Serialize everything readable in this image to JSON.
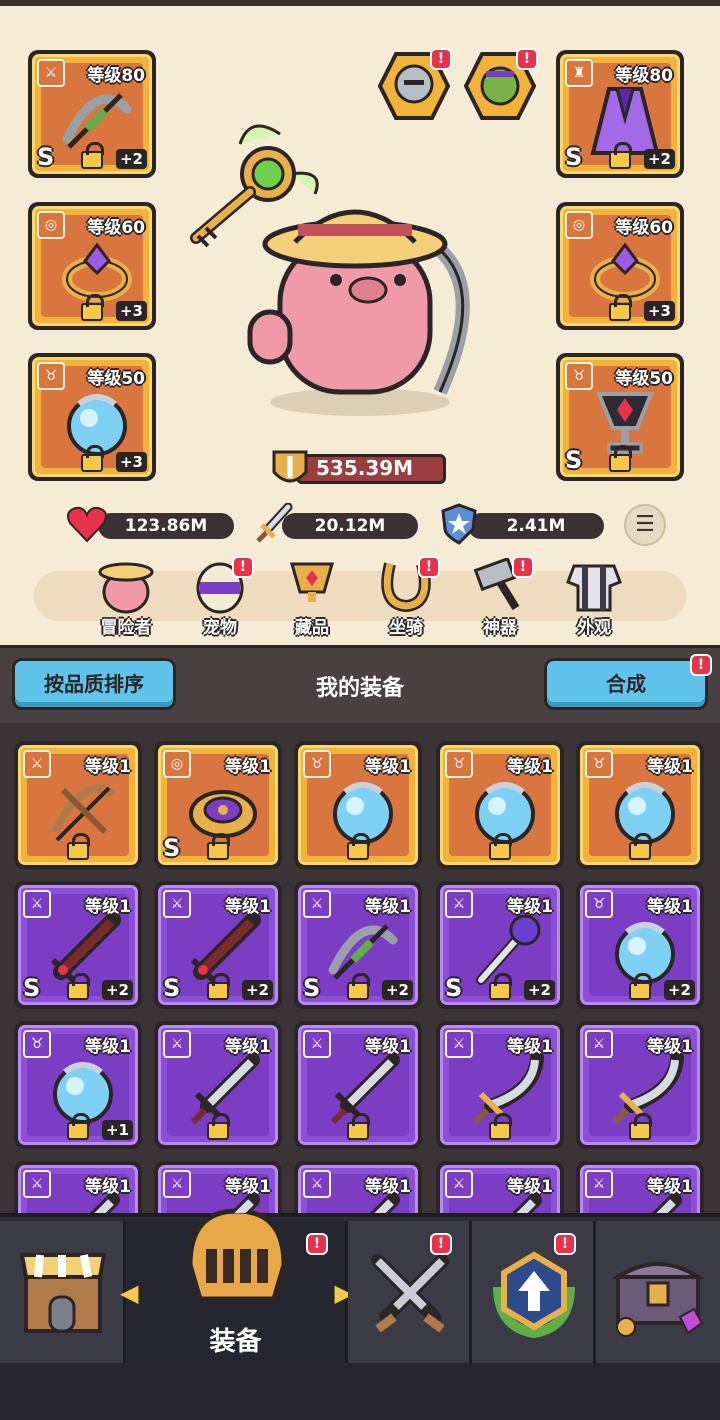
{
  "equipment_left": [
    {
      "name": "bow-slot",
      "tag_icon": "sword-icon",
      "level": "等级80",
      "grade": "S",
      "plus": "+2",
      "item_icon": "crossbow-icon"
    },
    {
      "name": "ring-slot",
      "tag_icon": "ring-icon",
      "level": "等级60",
      "grade": "",
      "plus": "+3",
      "item_icon": "gold-ring-icon"
    },
    {
      "name": "necklace-slot",
      "tag_icon": "necklace-icon",
      "level": "等级50",
      "grade": "",
      "plus": "+3",
      "item_icon": "blue-orb-icon"
    }
  ],
  "equipment_right": [
    {
      "name": "armor-slot",
      "tag_icon": "armor-icon",
      "level": "等级80",
      "grade": "S",
      "plus": "+2",
      "item_icon": "purple-cape-icon"
    },
    {
      "name": "ring-slot",
      "tag_icon": "ring-icon",
      "level": "等级60",
      "grade": "",
      "plus": "+3",
      "item_icon": "gold-ring-icon"
    },
    {
      "name": "trophy-slot",
      "tag_icon": "necklace-icon",
      "level": "等级50",
      "grade": "S",
      "plus": "",
      "item_icon": "red-gem-chalice-icon"
    }
  ],
  "companions": [
    {
      "icon": "knight-avatar-icon",
      "badge": "!"
    },
    {
      "icon": "orc-avatar-icon",
      "badge": "!"
    }
  ],
  "power": {
    "value": "535.39M",
    "icon": "sword-shield-icon"
  },
  "stats": [
    {
      "icon": "heart-icon",
      "value": "123.86M"
    },
    {
      "icon": "sword-icon",
      "value": "20.12M"
    },
    {
      "icon": "shield-icon",
      "value": "2.41M"
    }
  ],
  "nav": [
    {
      "label": "冒险者",
      "icon": "pig-hero-icon",
      "badge": ""
    },
    {
      "label": "宠物",
      "icon": "pet-egg-icon",
      "badge": "!"
    },
    {
      "label": "藏品",
      "icon": "trophy-icon",
      "badge": ""
    },
    {
      "label": "坐骑",
      "icon": "horseshoe-icon",
      "badge": "!"
    },
    {
      "label": "神器",
      "icon": "hammer-icon",
      "badge": "!"
    },
    {
      "label": "外观",
      "icon": "outfit-icon",
      "badge": ""
    }
  ],
  "header": {
    "sort_label": "按品质排序",
    "title": "我的装备",
    "merge_label": "合成",
    "merge_badge": "!"
  },
  "inventory": [
    {
      "rarity": "gold",
      "tag": "sword-icon",
      "level": "等级1",
      "grade": "",
      "plus": "",
      "item": "wooden-bow-icon"
    },
    {
      "rarity": "gold",
      "tag": "ring-icon",
      "level": "等级1",
      "grade": "S",
      "plus": "",
      "item": "purple-gem-ring-icon"
    },
    {
      "rarity": "gold",
      "tag": "necklace-icon",
      "level": "等级1",
      "grade": "",
      "plus": "",
      "item": "blue-orb-icon"
    },
    {
      "rarity": "gold",
      "tag": "necklace-icon",
      "level": "等级1",
      "grade": "",
      "plus": "",
      "item": "blue-orb-icon"
    },
    {
      "rarity": "gold",
      "tag": "necklace-icon",
      "level": "等级1",
      "grade": "",
      "plus": "",
      "item": "blue-orb-icon"
    },
    {
      "rarity": "purple",
      "tag": "sword-icon",
      "level": "等级1",
      "grade": "S",
      "plus": "+2",
      "item": "dark-sword-icon"
    },
    {
      "rarity": "purple",
      "tag": "sword-icon",
      "level": "等级1",
      "grade": "S",
      "plus": "+2",
      "item": "dark-sword-icon"
    },
    {
      "rarity": "purple",
      "tag": "sword-icon",
      "level": "等级1",
      "grade": "S",
      "plus": "+2",
      "item": "crossbow-icon"
    },
    {
      "rarity": "purple",
      "tag": "sword-icon",
      "level": "等级1",
      "grade": "S",
      "plus": "+2",
      "item": "magic-staff-icon"
    },
    {
      "rarity": "purple",
      "tag": "necklace-icon",
      "level": "等级1",
      "grade": "",
      "plus": "+2",
      "item": "blue-orb-icon"
    },
    {
      "rarity": "purple",
      "tag": "necklace-icon",
      "level": "等级1",
      "grade": "",
      "plus": "+1",
      "item": "blue-orb-icon"
    },
    {
      "rarity": "purple",
      "tag": "sword-icon",
      "level": "等级1",
      "grade": "",
      "plus": "",
      "item": "steel-sword-icon"
    },
    {
      "rarity": "purple",
      "tag": "sword-icon",
      "level": "等级1",
      "grade": "",
      "plus": "",
      "item": "steel-sword-icon"
    },
    {
      "rarity": "purple",
      "tag": "sword-icon",
      "level": "等级1",
      "grade": "",
      "plus": "",
      "item": "scimitar-icon"
    },
    {
      "rarity": "purple",
      "tag": "sword-icon",
      "level": "等级1",
      "grade": "",
      "plus": "",
      "item": "scimitar-icon"
    },
    {
      "rarity": "purple",
      "tag": "sword-icon",
      "level": "等级1",
      "grade": "",
      "plus": "",
      "item": "sword-icon"
    },
    {
      "rarity": "purple",
      "tag": "sword-icon",
      "level": "等级1",
      "grade": "",
      "plus": "",
      "item": "sword-icon"
    },
    {
      "rarity": "purple",
      "tag": "sword-icon",
      "level": "等级1",
      "grade": "",
      "plus": "",
      "item": "sword-icon"
    },
    {
      "rarity": "purple",
      "tag": "sword-icon",
      "level": "等级1",
      "grade": "",
      "plus": "",
      "item": "sword-icon"
    },
    {
      "rarity": "purple",
      "tag": "sword-icon",
      "level": "等级1",
      "grade": "",
      "plus": "",
      "item": "sword-icon"
    }
  ],
  "bottom_tabs": [
    {
      "icon": "shop-icon",
      "label": "",
      "badge": ""
    },
    {
      "icon": "helmet-icon",
      "label": "装备",
      "badge": "!"
    },
    {
      "icon": "crossed-swords-icon",
      "label": "",
      "badge": "!"
    },
    {
      "icon": "upgrade-emblem-icon",
      "label": "",
      "badge": "!"
    },
    {
      "icon": "treasure-chest-icon",
      "label": "",
      "badge": ""
    }
  ],
  "colors": {
    "gold_rarity": "#f2b33a",
    "purple_rarity": "#8c4fd8",
    "badge": "#e8324b",
    "button": "#5fc3ea",
    "background": "#f6ecd6"
  }
}
